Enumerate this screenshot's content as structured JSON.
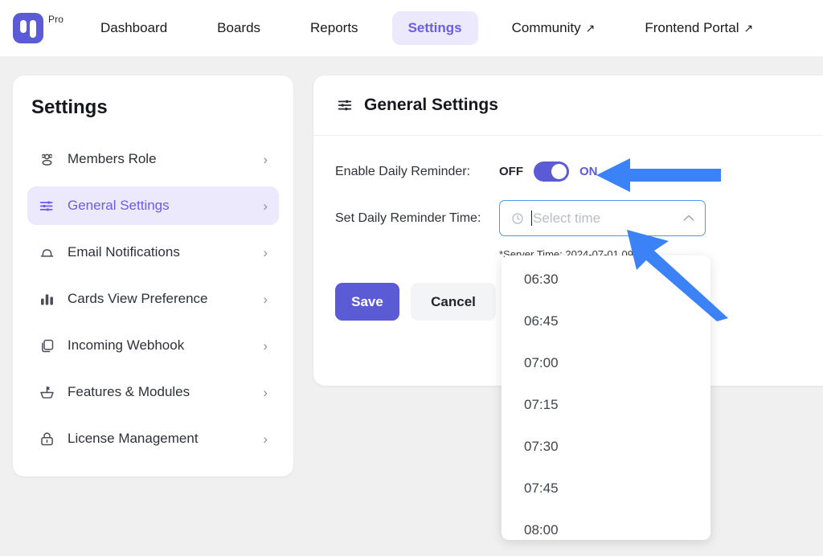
{
  "topbar": {
    "brand": {
      "tag": "Pro",
      "logo_icon": "app-logo-icon",
      "color": "#5b5bd6"
    },
    "nav": [
      {
        "label": "Dashboard",
        "external": false,
        "active": false
      },
      {
        "label": "Boards",
        "external": false,
        "active": false
      },
      {
        "label": "Reports",
        "external": false,
        "active": false
      },
      {
        "label": "Settings",
        "external": false,
        "active": true
      },
      {
        "label": "Community",
        "external": true,
        "active": false
      },
      {
        "label": "Frontend Portal",
        "external": true,
        "active": false
      }
    ],
    "external_glyph": "↗",
    "active_bg": "#ece9fd",
    "active_color": "#6c5ce7"
  },
  "sidebar": {
    "title": "Settings",
    "chevron_glyph": "›",
    "items": [
      {
        "label": "Members Role",
        "icon": "users-group-icon",
        "active": false
      },
      {
        "label": "General Settings",
        "icon": "sliders-icon",
        "active": true
      },
      {
        "label": "Email Notifications",
        "icon": "bell-icon",
        "active": false
      },
      {
        "label": "Cards View Preference",
        "icon": "bar-chart-icon",
        "active": false
      },
      {
        "label": "Incoming Webhook",
        "icon": "copy-icon",
        "active": false
      },
      {
        "label": "Features & Modules",
        "icon": "bowl-flag-icon",
        "active": false
      },
      {
        "label": "License Management",
        "icon": "lock-icon",
        "active": false
      }
    ]
  },
  "main": {
    "header": {
      "title": "General Settings",
      "icon": "sliders-icon"
    },
    "daily_reminder": {
      "label": "Enable Daily Reminder:",
      "off_text": "OFF",
      "on_text": "ON",
      "state": "ON",
      "toggle_color": "#5b5bd6"
    },
    "reminder_time": {
      "label": "Set Daily Reminder Time:",
      "placeholder": "Select time",
      "value": "",
      "clock_icon": "clock-icon",
      "chevron_icon": "chevron-up-icon",
      "chevron_glyph": "∧",
      "focus_border": "#4a9be0"
    },
    "server_note": "*Server Time: 2024-07-01 09:50",
    "buttons": {
      "save": "Save",
      "cancel": "Cancel",
      "save_bg": "#5b5bd6",
      "cancel_bg": "#f3f4f6"
    }
  },
  "time_dropdown": {
    "options": [
      "06:30",
      "06:45",
      "07:00",
      "07:15",
      "07:30",
      "07:45",
      "08:00"
    ]
  },
  "annotations": {
    "arrow_color": "#3b82f6",
    "items": [
      {
        "name": "arrow-pointing-to-toggle",
        "direction": "left"
      },
      {
        "name": "arrow-pointing-to-time-select",
        "direction": "up-left"
      }
    ]
  }
}
